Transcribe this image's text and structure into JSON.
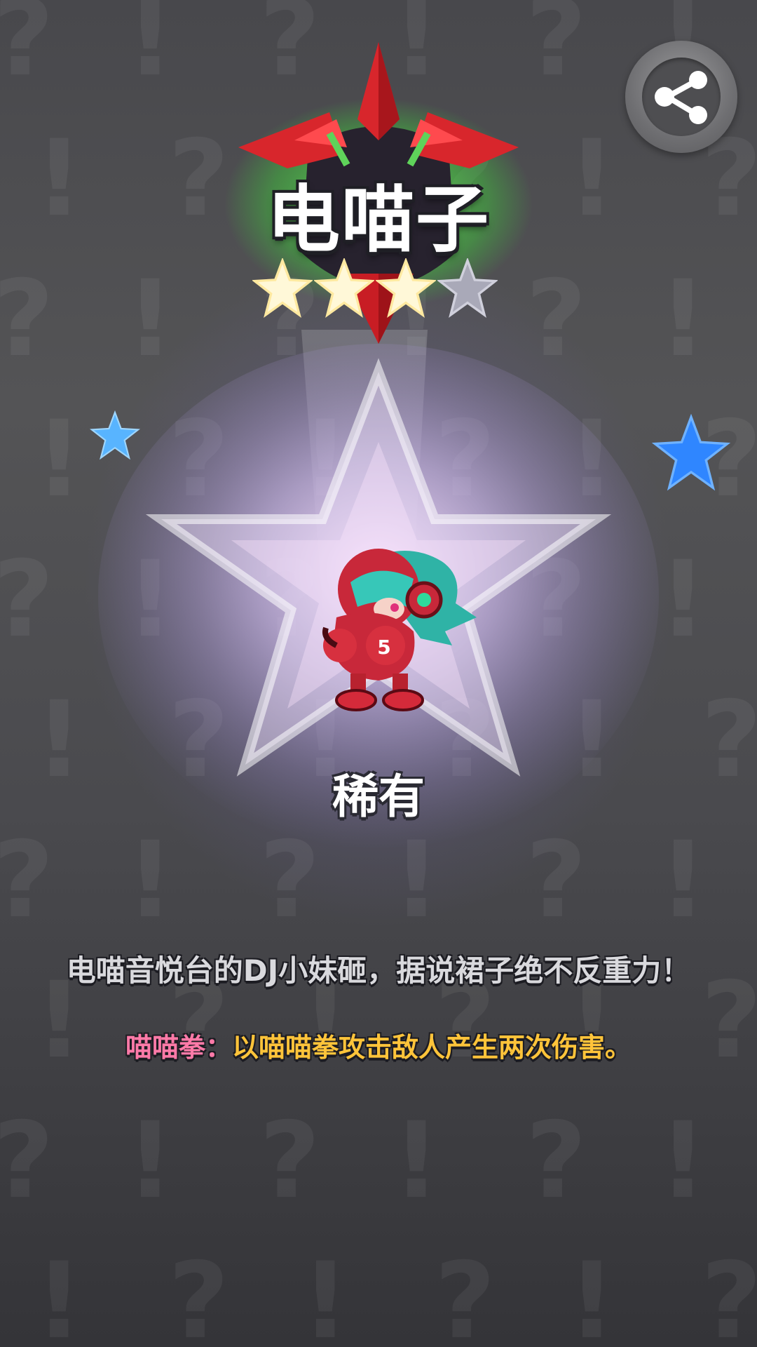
{
  "character": {
    "name": "电喵子",
    "rarity": "稀有",
    "stars_filled": 3,
    "stars_total": 4,
    "description": "电喵音悦台的DJ小妹砸，据说裙子绝不反重力！",
    "skill_name": "喵喵拳：",
    "skill_description": "以喵喵拳攻击敌人产生两次伤害。"
  },
  "share": {
    "icon": "share-icon"
  },
  "colors": {
    "skill_name": "#ff7aa8",
    "skill_description": "#ffc43a",
    "emblem_red": "#d8262c",
    "emblem_glow": "#5fd35a",
    "star_filled": "#fff6c8",
    "star_empty": "#a9a9b8",
    "deco_star": "#4aa8ff"
  }
}
